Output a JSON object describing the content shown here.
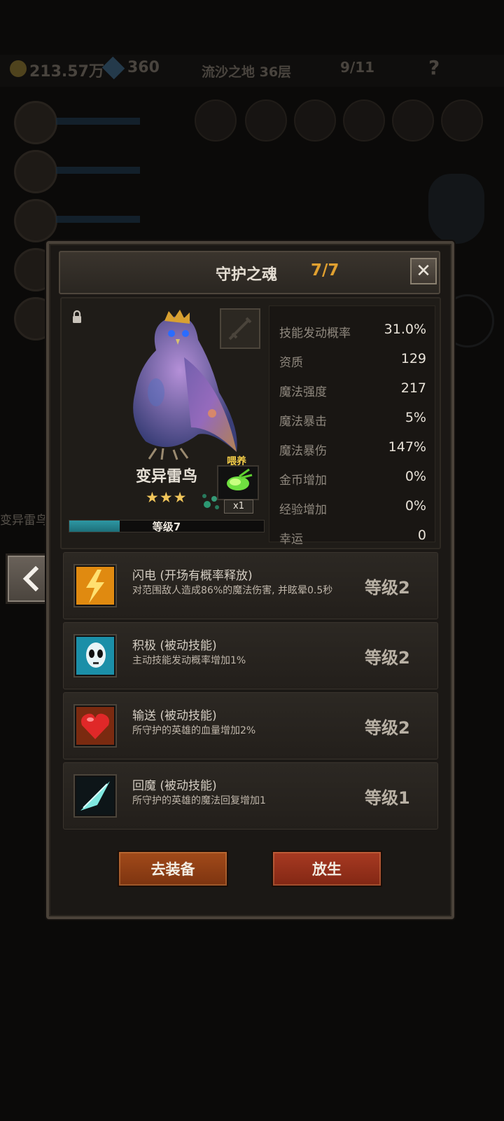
{
  "background": {
    "gold": "213.57万",
    "gems": "360",
    "location": "流沙之地 36层",
    "keys": "9/11",
    "help": "?",
    "side_name": "变异雷鸟"
  },
  "dialog": {
    "title": "守护之魂",
    "count": "7/7",
    "close_icon": "close-icon"
  },
  "pet": {
    "name": "变异雷鸟",
    "stars": "★★★",
    "star_count": 3,
    "level_label": "等级7",
    "exp_fraction": 0.26,
    "feed_label": "喂养",
    "feed_count": "x1"
  },
  "stats": [
    {
      "label": "技能发动概率",
      "value": "31.0%"
    },
    {
      "label": "资质",
      "value": "129"
    },
    {
      "label": "魔法强度",
      "value": "217"
    },
    {
      "label": "魔法暴击",
      "value": "5%"
    },
    {
      "label": "魔法暴伤",
      "value": "147%"
    },
    {
      "label": "金币增加",
      "value": "0%"
    },
    {
      "label": "经验增加",
      "value": "0%"
    },
    {
      "label": "幸运",
      "value": "0"
    }
  ],
  "skills": [
    {
      "name": "闪电 (开场有概率释放)",
      "desc": "对范围敌人造成86%的魔法伤害, 并眩晕0.5秒",
      "level": "等级2",
      "icon": "lightning-icon"
    },
    {
      "name": "积极 (被动技能)",
      "desc": "主动技能发动概率增加1%",
      "level": "等级2",
      "icon": "mask-icon"
    },
    {
      "name": "输送 (被动技能)",
      "desc": "所守护的英雄的血量增加2%",
      "level": "等级2",
      "icon": "heart-icon"
    },
    {
      "name": "回魔 (被动技能)",
      "desc": "所守护的英雄的魔法回复增加1",
      "level": "等级1",
      "icon": "blade-icon"
    }
  ],
  "buttons": {
    "equip": "去装备",
    "release": "放生"
  }
}
